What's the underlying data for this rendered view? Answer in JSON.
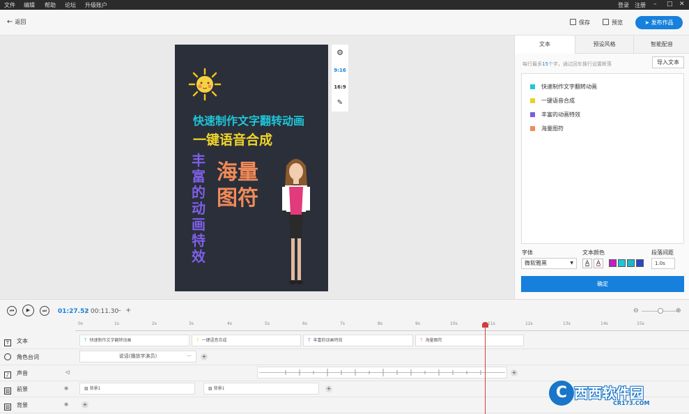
{
  "menu": [
    "文件",
    "编辑",
    "帮助",
    "论坛",
    "升级账户"
  ],
  "menu_right": [
    "登录",
    "注册"
  ],
  "back_label": "返回",
  "toolbar": {
    "save": "保存",
    "preview": "预览",
    "publish": "发布作品"
  },
  "canvas": {
    "line1": "快速制作文字翻转动画",
    "line2": "一键语音合成",
    "line3": "丰富的动画特效",
    "line4a": "海量",
    "line4b": "图符"
  },
  "sidetools": {
    "ratio1": "9:16",
    "ratio2": "16:9"
  },
  "right_panel": {
    "tabs": [
      "文本",
      "预设风格",
      "智能配音"
    ],
    "hint_prefix": "每行最多",
    "hint_num": "15",
    "hint_suffix": "个字，通过回车换行设置断落",
    "import": "导入文本",
    "lines": [
      {
        "text": "快速制作文字翻转动画",
        "color": "#1fc6d9"
      },
      {
        "text": "一键语音合成",
        "color": "#e6d22a"
      },
      {
        "text": "丰富的动画特效",
        "color": "#7a5ce0"
      },
      {
        "text": "海量图符",
        "color": "#ef8a5a"
      }
    ],
    "font_label": "字体",
    "font_value": "微软雅黑",
    "color_label": "文本颜色",
    "spacing_label": "段落间距",
    "spacing_value": "1.0s",
    "swatches": [
      "#c31fc6",
      "#1fc6d9",
      "#19b9c9",
      "#2c46c9"
    ],
    "confirm": "确定"
  },
  "timeline": {
    "current": "01:27.52",
    "total": "00:11.30",
    "ruler": [
      "0s",
      "1s",
      "2s",
      "3s",
      "4s",
      "5s",
      "6s",
      "7s",
      "8s",
      "9s",
      "10s",
      "11s",
      "12s",
      "13s",
      "14s",
      "15s"
    ],
    "tracks": [
      {
        "label": "文本",
        "icon": "T"
      },
      {
        "label": "角色台词",
        "icon": "人"
      },
      {
        "label": "声音",
        "icon": "♪"
      },
      {
        "label": "前景",
        "icon": "▨"
      },
      {
        "label": "背景",
        "icon": "▨"
      }
    ],
    "text_clips": [
      "快速制作文字翻转动画",
      "一键语音合成",
      "丰富的动画特效",
      "海量图符"
    ],
    "role_clip": "说话(播放字演员)",
    "fg_clips": [
      "背景1",
      "背景1"
    ]
  },
  "watermark": {
    "main": "西西软件园",
    "sub": "CR173.COM"
  }
}
